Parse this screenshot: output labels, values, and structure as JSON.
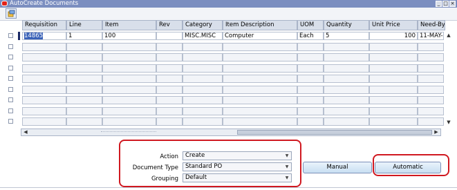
{
  "window": {
    "title": "AutoCreate Documents"
  },
  "columns": [
    "Requisition",
    "Line",
    "Item",
    "Rev",
    "Category",
    "Item Description",
    "UOM",
    "Quantity",
    "Unit Price",
    "Need-By"
  ],
  "rows": [
    {
      "requisition": "14865",
      "line": "1",
      "item": "100",
      "rev": "",
      "category": "MISC.MISC",
      "description": "Computer",
      "uom": "Each",
      "quantity": "5",
      "unit_price": "100",
      "need_by": "11-MAY-"
    }
  ],
  "form": {
    "action_label": "Action",
    "action_value": "Create",
    "doctype_label": "Document Type",
    "doctype_value": "Standard PO",
    "grouping_label": "Grouping",
    "grouping_value": "Default"
  },
  "buttons": {
    "manual": "Manual",
    "automatic": "Automatic"
  },
  "colors": {
    "title_bar": "#7b8ec0",
    "highlight": "#d01820",
    "selection": "#3a62b8"
  },
  "icons": [
    "app-icon",
    "minimize-icon",
    "maximize-icon",
    "close-icon",
    "toolbar-icon"
  ]
}
